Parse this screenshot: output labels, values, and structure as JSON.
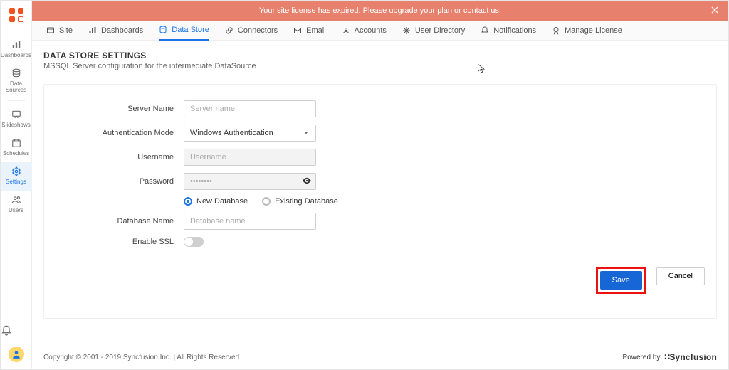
{
  "banner": {
    "prefix": "Your site license has expired. Please ",
    "link1": "upgrade your plan",
    "mid": " or ",
    "link2": "contact us",
    "suffix": "."
  },
  "sidebar": {
    "items": [
      {
        "label": "Dashboards"
      },
      {
        "label": "Data Sources"
      },
      {
        "label": "Slideshows"
      },
      {
        "label": "Schedules"
      },
      {
        "label": "Settings"
      },
      {
        "label": "Users"
      }
    ]
  },
  "tabs": [
    {
      "label": "Site"
    },
    {
      "label": "Dashboards"
    },
    {
      "label": "Data Store"
    },
    {
      "label": "Connectors"
    },
    {
      "label": "Email"
    },
    {
      "label": "Accounts"
    },
    {
      "label": "User Directory"
    },
    {
      "label": "Notifications"
    },
    {
      "label": "Manage License"
    }
  ],
  "page": {
    "title": "DATA STORE SETTINGS",
    "subtitle": "MSSQL Server configuration for the intermediate DataSource"
  },
  "form": {
    "server_label": "Server Name",
    "server_placeholder": "Server name",
    "auth_label": "Authentication Mode",
    "auth_value": "Windows Authentication",
    "user_label": "Username",
    "user_placeholder": "Username",
    "pass_label": "Password",
    "pass_value": "••••••••",
    "radio_new": "New Database",
    "radio_existing": "Existing Database",
    "db_label": "Database Name",
    "db_placeholder": "Database name",
    "ssl_label": "Enable SSL"
  },
  "actions": {
    "save": "Save",
    "cancel": "Cancel"
  },
  "footer": {
    "left": "Copyright © 2001 - 2019 Syncfusion Inc.    |    All Rights Reserved",
    "powered": "Powered by",
    "brand": "Syncfusion"
  }
}
